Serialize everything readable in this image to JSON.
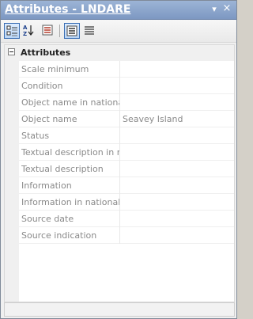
{
  "window": {
    "title": "Attributes - LNDARE",
    "pin_glyph": "▾",
    "close_glyph": "×"
  },
  "toolbar": {
    "buttons": [
      {
        "icon": "categorized-icon",
        "active": true
      },
      {
        "icon": "alphabetical-sort-icon",
        "label": "AZ",
        "active": false
      },
      {
        "icon": "property-pages-icon",
        "active": false
      },
      {
        "icon": "description-view-icon",
        "active": true
      },
      {
        "icon": "list-view-icon",
        "active": false
      }
    ]
  },
  "category": {
    "name": "Attributes",
    "expander_state": "collapse"
  },
  "properties": [
    {
      "name": "Scale minimum",
      "value": ""
    },
    {
      "name": "Condition",
      "value": ""
    },
    {
      "name": "Object name in nationa",
      "value": ""
    },
    {
      "name": "Object name",
      "value": "Seavey Island"
    },
    {
      "name": "Status",
      "value": ""
    },
    {
      "name": "Textual description in n",
      "value": ""
    },
    {
      "name": "Textual description",
      "value": ""
    },
    {
      "name": "Information",
      "value": ""
    },
    {
      "name": "Information in national",
      "value": ""
    },
    {
      "name": "Source date",
      "value": ""
    },
    {
      "name": "Source indication",
      "value": ""
    }
  ],
  "colors": {
    "titlebar": "#8aa6cf",
    "selected_tool_border": "#3c6fb4",
    "muted_text": "#8a8a8a"
  }
}
